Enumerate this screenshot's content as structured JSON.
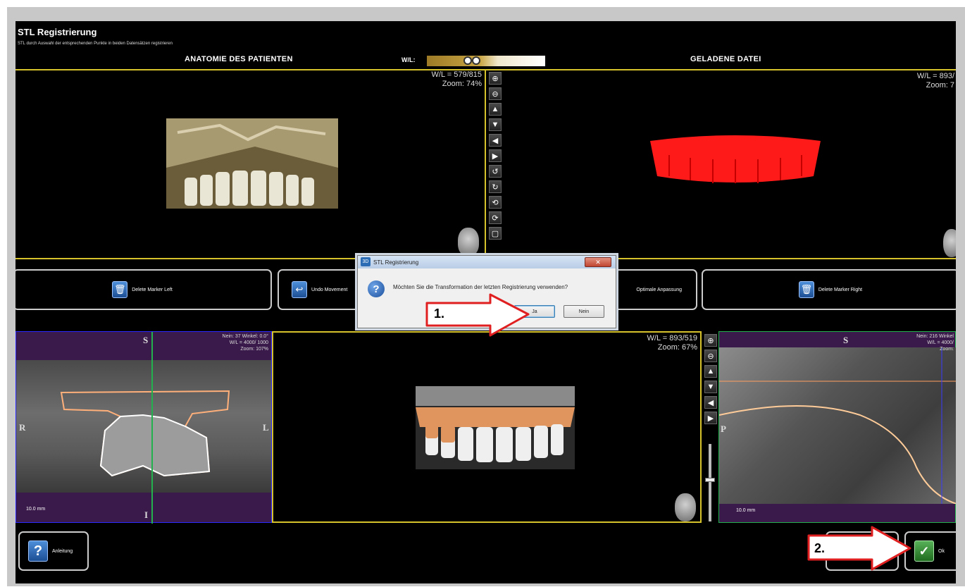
{
  "app": {
    "title": "STL Registrierung",
    "subtitle": "STL durch Auswahl der entsprechenden Punkte in beiden Datensätzen registrieren"
  },
  "headers": {
    "left": "ANATOMIE DES PATIENTEN",
    "right": "GELADENE DATEI",
    "wl_label": "W/L:"
  },
  "top_left_view": {
    "wl": "W/L = 579/815",
    "zoom": "Zoom: 74%"
  },
  "top_right_view": {
    "wl": "W/L = 893/",
    "zoom": "Zoom: 7"
  },
  "bottom_left_view": {
    "info1": "Nein: 37 Winkel: 0.0°",
    "info2": "W/L = 4000/ 1000",
    "info3": "Zoom: 107%",
    "scale": "10.0 mm",
    "top_orient": "S",
    "left_orient": "R",
    "right_orient": "L",
    "bottom_orient": "I"
  },
  "bottom_center_view": {
    "wl": "W/L = 893/519",
    "zoom": "Zoom: 67%"
  },
  "bottom_right_view": {
    "info1": "Nein: 216 Winkel",
    "info2": "W/L = 4000/",
    "info3": "Zoom:",
    "scale": "10.0 mm",
    "top_orient": "S",
    "left_orient": "P"
  },
  "buttons": {
    "delete_left": "Delete Marker Left",
    "undo": "Undo Movement",
    "optimal": "Optimale Anpassung",
    "delete_right": "Delete Marker Right",
    "help": "Anleitung",
    "ok": "Ok"
  },
  "dialog": {
    "title": "STL Registrierung",
    "close": "✕",
    "message": "Möchten Sie die Transformation der letzten Registrierung verwenden?",
    "yes": "Ja",
    "no": "Nein"
  },
  "callouts": {
    "step1": "1.",
    "step2": "2."
  },
  "icons": {
    "zoom_in": "zoom-in-icon",
    "zoom_out": "zoom-out-icon",
    "up": "arrow-up-icon",
    "down": "arrow-down-icon",
    "left": "arrow-left-icon",
    "right": "arrow-right-icon",
    "rotate_ccw": "rotate-ccw-icon",
    "rotate_cw": "rotate-cw-icon",
    "flip_h": "flip-horizontal-icon",
    "flip_v": "flip-vertical-icon"
  },
  "colors": {
    "panel_border": "#d6c22a",
    "marker_line": "#22b14c",
    "accent_blue": "#1d4f94",
    "stl_red": "#ff1a1a",
    "slice_purple": "#5b2a6e"
  }
}
